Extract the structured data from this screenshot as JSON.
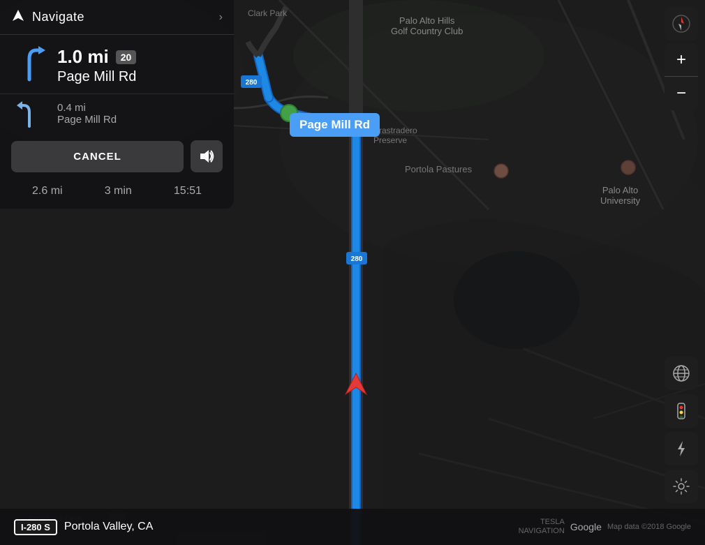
{
  "nav_panel": {
    "header": {
      "title": "Navigate",
      "chevron": "›"
    },
    "primary_direction": {
      "distance": "1.0 mi",
      "speed_limit": "20",
      "street": "Page Mill Rd"
    },
    "secondary_direction": {
      "distance": "0.4 mi",
      "street": "Page Mill Rd"
    },
    "cancel_label": "CANCEL",
    "trip_stats": {
      "distance": "2.6 mi",
      "time": "3 min",
      "eta": "15:51"
    }
  },
  "map": {
    "street_label": "Page Mill Rd",
    "highway": "280",
    "bottom_road": "I-280 S",
    "bottom_location": "Portola Valley, CA",
    "map_data": "Map data ©2018 Google"
  },
  "bottom_bar": {
    "road_badge": "I-280 S",
    "road_name": "Portola Valley, CA",
    "tesla_nav": "TESLA\nNAVIGATION",
    "google": "Google",
    "map_data": "Map data ©2018 Google"
  },
  "icons": {
    "navigate_icon": "⊳",
    "sound_icon": "🔊",
    "zoom_in": "+",
    "zoom_out": "−",
    "globe": "🌐",
    "traffic": "🚦",
    "lightning": "⚡",
    "gear": "⚙"
  }
}
